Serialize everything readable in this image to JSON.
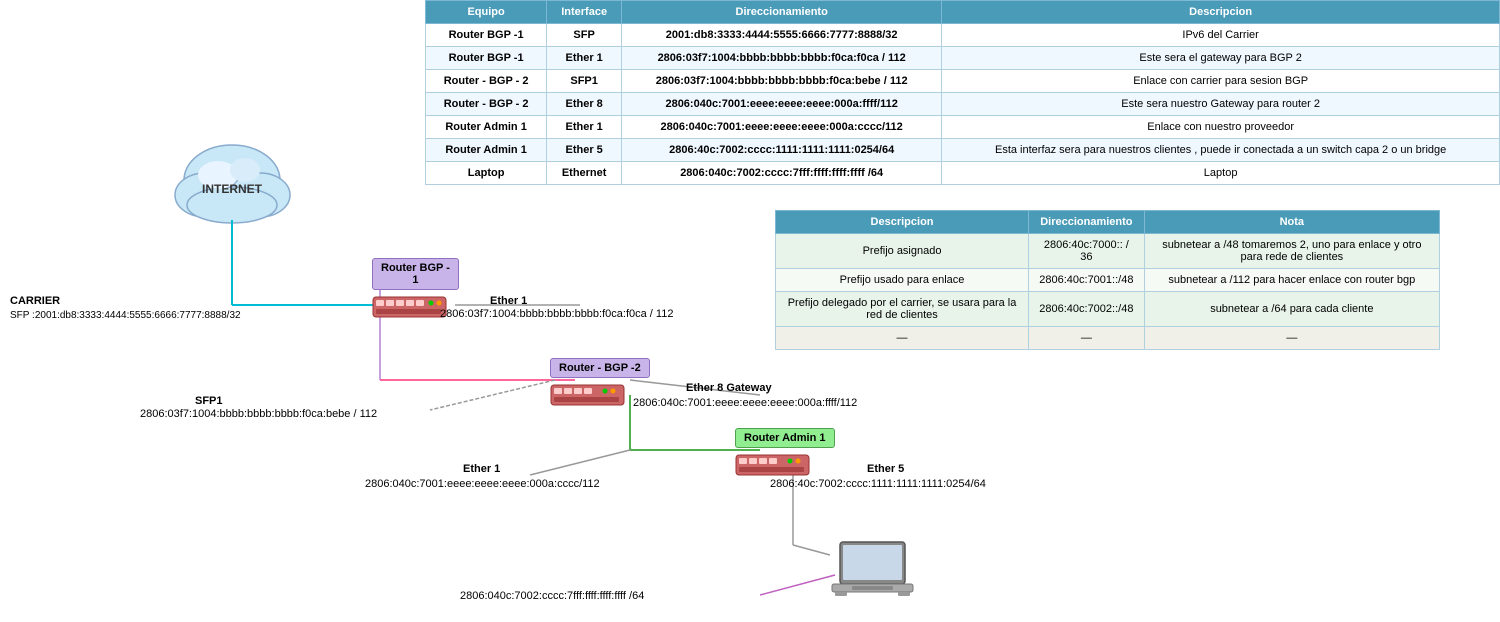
{
  "header": {
    "col1": "Equipo",
    "col2": "Interface",
    "col3": "Direccionamiento",
    "col4": "Descripcion"
  },
  "main_table_rows": [
    {
      "equipo": "Router BGP -1",
      "interface": "SFP",
      "dir": "2001:db8:3333:4444:5555:6666:7777:8888/32",
      "desc": "IPv6 del Carrier"
    },
    {
      "equipo": "Router BGP -1",
      "interface": "Ether 1",
      "dir": "2806:03f7:1004:bbbb:bbbb:bbbb:f0ca:f0ca / 112",
      "desc": "Este sera el gateway para BGP 2"
    },
    {
      "equipo": "Router - BGP - 2",
      "interface": "SFP1",
      "dir": "2806:03f7:1004:bbbb:bbbb:bbbb:f0ca:bebe / 112",
      "desc": "Enlace con carrier para sesion BGP"
    },
    {
      "equipo": "Router - BGP - 2",
      "interface": "Ether 8",
      "dir": "2806:040c:7001:eeee:eeee:eeee:000a:ffff/112",
      "desc": "Este sera nuestro Gateway para router 2"
    },
    {
      "equipo": "Router Admin 1",
      "interface": "Ether 1",
      "dir": "2806:040c:7001:eeee:eeee:eeee:000a:cccc/112",
      "desc": "Enlace con nuestro proveedor"
    },
    {
      "equipo": "Router Admin 1",
      "interface": "Ether 5",
      "dir": "2806:40c:7002:cccc:1111:1111:1111:0254/64",
      "desc": "Esta interfaz sera para nuestros clientes , puede ir conectada a un switch capa 2 o un bridge"
    },
    {
      "equipo": "Laptop",
      "interface": "Ethernet",
      "dir": "2806:040c:7002:cccc:7fff:ffff:ffff:ffff /64",
      "desc": "Laptop"
    }
  ],
  "second_table": {
    "col1": "Descripcion",
    "col2": "Direccionamiento",
    "col3": "Nota",
    "rows": [
      {
        "desc": "Prefijo asignado",
        "dir": "2806:40c:7000:: / 36",
        "nota": "subnetear a /48  tomaremos 2, uno para enlace y otro para rede de clientes"
      },
      {
        "desc": "Prefijo usado para enlace",
        "dir": "2806:40c:7001::/48",
        "nota": "subnetear a /112 para hacer enlace con router bgp"
      },
      {
        "desc": "Prefijo delegado por el carrier, se usara para la red de clientes",
        "dir": "2806:40c:7002::/48",
        "nota": "subnetear a /64 para cada cliente"
      },
      {
        "desc": "—",
        "dir": "—",
        "nota": "—"
      }
    ]
  },
  "diagram": {
    "internet_label": "INTERNET",
    "carrier_label": "CARRIER",
    "carrier_ip": "SFP :2001:db8:3333:4444:5555:6666:7777:8888/32",
    "router_bgp1_label": "Router BGP -\n1",
    "router_bgp2_label": "Router - BGP -2",
    "router_admin1_label": "Router Admin 1",
    "ether1_label1": "Ether 1",
    "ether1_ip1": "2806:03f7:1004:bbbb:bbbb:bbbb:f0ca:f0ca / 112",
    "sfp1_label": "SFP1",
    "sfp1_ip": "2806:03f7:1004:bbbb:bbbb:bbbb:f0ca:bebe / 112",
    "ether8_label": "Ether 8 Gateway",
    "ether8_ip": "2806:040c:7001:eeee:eeee:eeee:000a:ffff/112",
    "ether1_label2": "Ether 1",
    "ether1_ip2": "2806:040c:7001:eeee:eeee:eeee:000a:cccc/112",
    "ether5_label": "Ether 5",
    "ether5_ip": "2806:40c:7002:cccc:1111:1111:1111:0254/64",
    "laptop_ip": "2806:040c:7002:cccc:7fff:ffff:ffff:ffff /64"
  }
}
